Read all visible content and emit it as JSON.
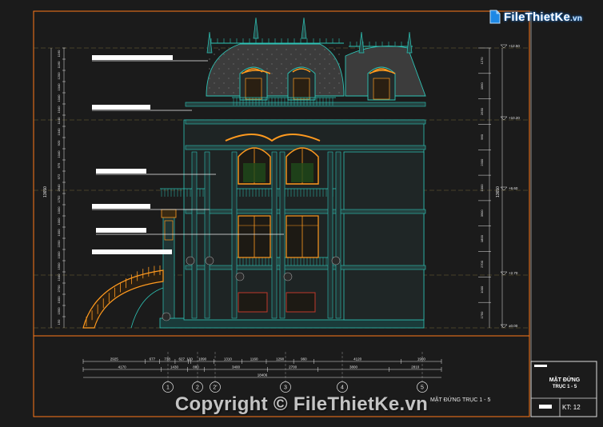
{
  "logo": {
    "brand": "FileThietKe",
    "suffix": ".vn"
  },
  "watermark": "Copyright © FileThietKe.vn",
  "title_block": {
    "title_line1": "MẶT ĐỨNG",
    "title_line2": "TRỤC 1 - 5",
    "sheet": "KT: 12"
  },
  "caption": "MẶT ĐỨNG TRỤC 1 - 5",
  "left_dims": {
    "outer_total": "13650",
    "segments": [
      "1160",
      "1160",
      "1200",
      "1040",
      "1040",
      "1040",
      "1140",
      "1040",
      "920",
      "1040",
      "975",
      "972",
      "2640",
      "1752",
      "1000",
      "1000",
      "1000",
      "2200",
      "1000",
      "1500",
      "1040",
      "2700",
      "1000",
      "1500",
      "150"
    ]
  },
  "right_dims": {
    "outer_total": "13650",
    "segments": [
      "1270",
      "1960",
      "2630",
      "960",
      "2300",
      "1000",
      "3900",
      "1800",
      "2700",
      "1000",
      "1750"
    ]
  },
  "levels": [
    "+12.50",
    "+10.20",
    "+6.60",
    "+2.70",
    "±0.00"
  ],
  "bottom_dims": {
    "row1": [
      "2925",
      "677",
      "738",
      "627",
      "120",
      "1090",
      "1310",
      "1160",
      "1290",
      "960",
      "4120",
      "1900"
    ],
    "row2": [
      "4170",
      "1430",
      "880",
      "3400",
      "2700",
      "3800",
      "2810"
    ],
    "total": "18406"
  },
  "axes": [
    "1",
    "2",
    "2'",
    "3",
    "4",
    "5"
  ],
  "colors": {
    "bg": "#1b1b1b",
    "border": "#ff7a1a",
    "structure": "#2ec4b6",
    "accent": "#ff9a1f",
    "dims": "#e6e6e6"
  }
}
